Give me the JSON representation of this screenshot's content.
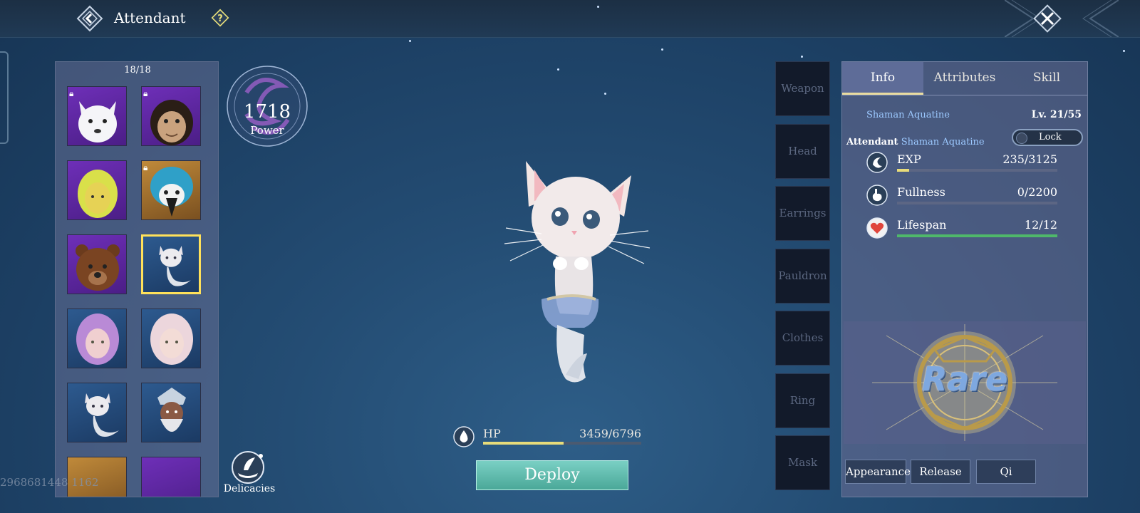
{
  "header": {
    "title": "Attendant"
  },
  "roster": {
    "count": "18/18",
    "slots": [
      {
        "name": "arctic-fox",
        "bg": "purple",
        "locked": true
      },
      {
        "name": "chimpanzee",
        "bg": "purple",
        "locked": true
      },
      {
        "name": "blonde-doll",
        "bg": "purple",
        "locked": false
      },
      {
        "name": "macaw",
        "bg": "gold",
        "locked": true
      },
      {
        "name": "bear",
        "bg": "purple",
        "locked": false
      },
      {
        "name": "shaman-aquatine",
        "bg": "blue",
        "locked": false,
        "selected": true
      },
      {
        "name": "purple-haired-girl",
        "bg": "blue",
        "locked": false
      },
      {
        "name": "white-haired-girl",
        "bg": "blue",
        "locked": false
      },
      {
        "name": "shaman-aquatine-2",
        "bg": "blue",
        "locked": false
      },
      {
        "name": "elder",
        "bg": "blue",
        "locked": false
      }
    ]
  },
  "power": {
    "value": "1718",
    "label": "Power"
  },
  "delicacies": {
    "label": "Delicacies"
  },
  "uid": "2968681448 1162",
  "hp": {
    "label": "HP",
    "value": "3459/6796",
    "fraction": 0.509
  },
  "deploy": {
    "label": "Deploy"
  },
  "equipment": [
    {
      "label": "Weapon"
    },
    {
      "label": "Head"
    },
    {
      "label": "Earrings"
    },
    {
      "label": "Pauldron"
    },
    {
      "label": "Clothes"
    },
    {
      "label": "Ring"
    },
    {
      "label": "Mask"
    }
  ],
  "panel": {
    "tabs": [
      {
        "label": "Info",
        "active": true
      },
      {
        "label": "Attributes",
        "active": false
      },
      {
        "label": "Skill",
        "active": false
      }
    ],
    "pet_name": "Shaman Aquatine",
    "level": "Lv. 21/55",
    "attendant_label": "Attendant",
    "attendant_name": "Shaman Aquatine",
    "lock_label": "Lock",
    "stats": [
      {
        "label": "EXP",
        "value": "235/3125",
        "fraction": 0.075,
        "color": "#e8dc7a",
        "icon": "exp-icon"
      },
      {
        "label": "Fullness",
        "value": "0/2200",
        "fraction": 0,
        "color": "#e8dc7a",
        "icon": "stomach-icon"
      },
      {
        "label": "Lifespan",
        "value": "12/12",
        "fraction": 1,
        "color": "#4fb86a",
        "icon": "heart-icon"
      }
    ],
    "rarity": "Rare",
    "actions": [
      {
        "label": "Appearance"
      },
      {
        "label": "Release"
      },
      {
        "label": "Qi"
      }
    ]
  }
}
